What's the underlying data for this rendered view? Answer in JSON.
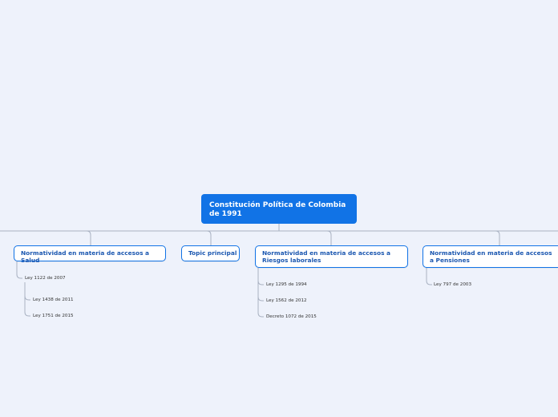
{
  "central_topic": {
    "label": "Constitución Política de Colombia de 1991"
  },
  "topics": [
    {
      "label": "Normatividad en materia de accesos a Salud",
      "children": [
        {
          "label": "Ley 1122 de 2007",
          "children": [
            {
              "label": "Ley 1438 de 2011"
            },
            {
              "label": "Ley 1751 de 2015"
            }
          ]
        }
      ]
    },
    {
      "label": "Topic principal",
      "children": []
    },
    {
      "label": "Normatividad en materia de accesos a Riesgos laborales",
      "children": [
        {
          "label": "Ley 1295 de 1994"
        },
        {
          "label": "Ley 1562 de 2012"
        },
        {
          "label": "Decreto 1072 de 2015"
        }
      ]
    },
    {
      "label": "Normatividad en materia de accesos a Pensiones",
      "children": [
        {
          "label": "Ley 797 de 2003"
        }
      ]
    }
  ],
  "colors": {
    "background": "#eef2fb",
    "central_fill": "#1173e6",
    "topic_border": "#1173e6",
    "topic_text": "#1b57b0",
    "connector": "#a9b2c2"
  }
}
